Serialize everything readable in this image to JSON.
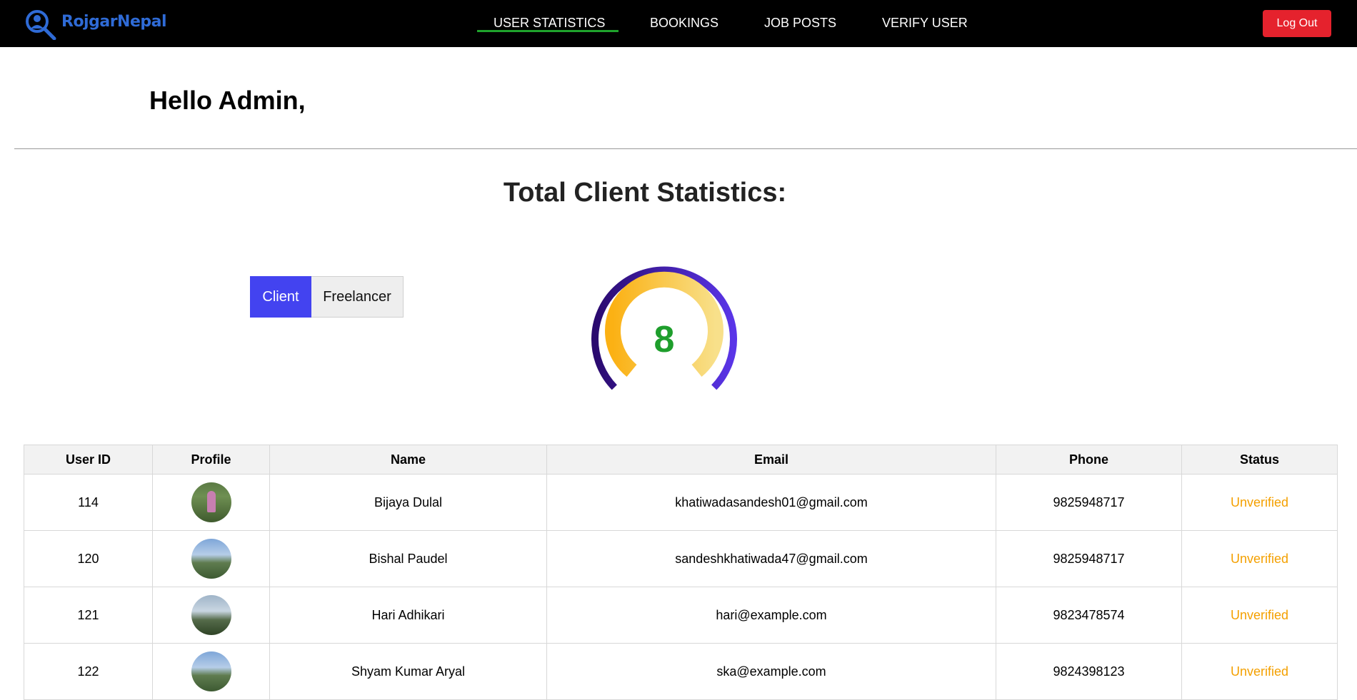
{
  "brand": {
    "name": "RojgarNepal"
  },
  "nav": {
    "items": [
      {
        "label": "USER STATISTICS",
        "active": true
      },
      {
        "label": "BOOKINGS"
      },
      {
        "label": "JOB POSTS"
      },
      {
        "label": "VERIFY USER"
      }
    ],
    "logout_label": "Log Out"
  },
  "greeting": "Hello Admin,",
  "stats": {
    "title": "Total Client Statistics:",
    "toggle": {
      "client_label": "Client",
      "freelancer_label": "Freelancer",
      "selected": "Client"
    },
    "gauge_value": "8"
  },
  "table": {
    "columns": [
      "User ID",
      "Profile",
      "Name",
      "Email",
      "Phone",
      "Status"
    ],
    "rows": [
      {
        "id": "114",
        "avatar": "person-photo",
        "name": "Bijaya Dulal",
        "email": "khatiwadasandesh01@gmail.com",
        "phone": "9825948717",
        "status": "Unverified"
      },
      {
        "id": "120",
        "avatar": "landscape-photo",
        "name": "Bishal Paudel",
        "email": "sandeshkhatiwada47@gmail.com",
        "phone": "9825948717",
        "status": "Unverified"
      },
      {
        "id": "121",
        "avatar": "landscape-photo",
        "name": "Hari Adhikari",
        "email": "hari@example.com",
        "phone": "9823478574",
        "status": "Unverified"
      },
      {
        "id": "122",
        "avatar": "landscape-photo",
        "name": "Shyam Kumar Aryal",
        "email": "ska@example.com",
        "phone": "9824398123",
        "status": "Unverified"
      }
    ]
  },
  "colors": {
    "navbar": "#000000",
    "accent_blue": "#4343f0",
    "logout_red": "#e5222d",
    "status_orange": "#f4a000",
    "gauge_value_green": "#1e9e2c"
  }
}
